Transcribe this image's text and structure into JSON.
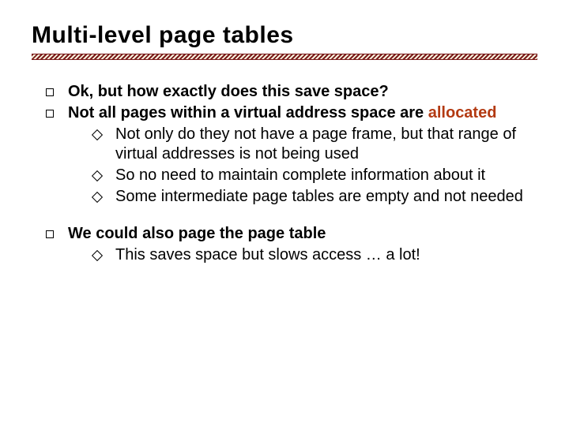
{
  "title": "Multi-level page tables",
  "colors": {
    "accent": "#b33a12",
    "rule_dark": "#7a1a1a",
    "rule_light": "#f6f0dc"
  },
  "b1": {
    "text": "Ok, but how exactly does this save space?"
  },
  "b2": {
    "prefix": "Not all pages within a virtual address space are ",
    "accent": "allocated",
    "sub": [
      "Not only do they not have a page frame, but that range of virtual addresses is not being used",
      "So no need to maintain complete information about it",
      "Some intermediate page tables are empty and not needed"
    ]
  },
  "b3": {
    "text": "We could also page the page table",
    "sub": [
      "This saves space but slows access … a lot!"
    ]
  }
}
